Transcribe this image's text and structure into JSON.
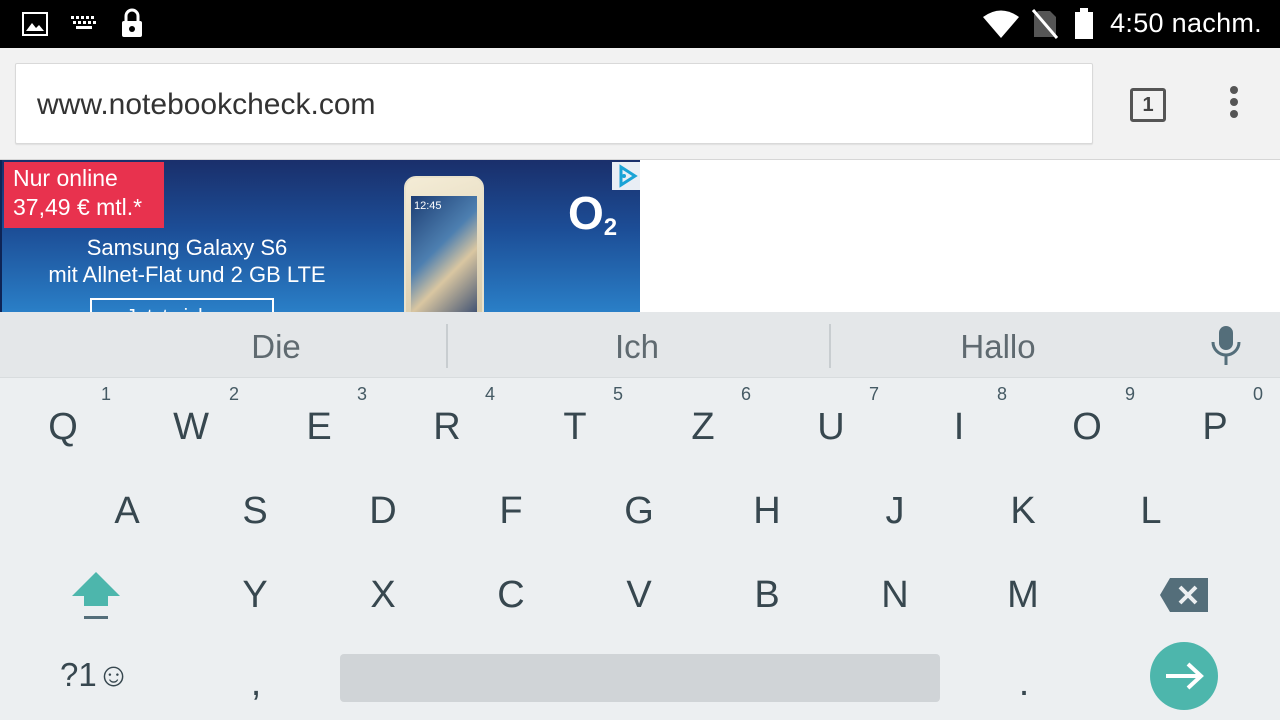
{
  "status_bar": {
    "time": "4:50 nachm.",
    "icons": [
      "gallery-icon",
      "keyboard-icon",
      "lock-icon",
      "wifi-icon",
      "no-sim-icon",
      "battery-icon"
    ]
  },
  "browser": {
    "url": "www.notebookcheck.com",
    "tab_count": "1"
  },
  "ad": {
    "badge_line1": "Nur online",
    "badge_line2": "37,49 € mtl.*",
    "title_line1": "Samsung Galaxy S6",
    "title_line2": "mit Allnet-Flat und 2 GB LTE",
    "cta": "Jetzt sichern",
    "phone_clock": "12:45",
    "brand": "O",
    "brand_sub": "2"
  },
  "keyboard": {
    "suggestions": [
      "Die",
      "Ich",
      "Hallo"
    ],
    "row1": [
      {
        "key": "Q",
        "hint": "1"
      },
      {
        "key": "W",
        "hint": "2"
      },
      {
        "key": "E",
        "hint": "3"
      },
      {
        "key": "R",
        "hint": "4"
      },
      {
        "key": "T",
        "hint": "5"
      },
      {
        "key": "Z",
        "hint": "6"
      },
      {
        "key": "U",
        "hint": "7"
      },
      {
        "key": "I",
        "hint": "8"
      },
      {
        "key": "O",
        "hint": "9"
      },
      {
        "key": "P",
        "hint": "0"
      }
    ],
    "row2": [
      "A",
      "S",
      "D",
      "F",
      "G",
      "H",
      "J",
      "K",
      "L"
    ],
    "row3": [
      "Y",
      "X",
      "C",
      "V",
      "B",
      "N",
      "M"
    ],
    "symbols_label": "?1☺",
    "comma": ",",
    "period": ".",
    "accent_color": "#4db6ac"
  }
}
